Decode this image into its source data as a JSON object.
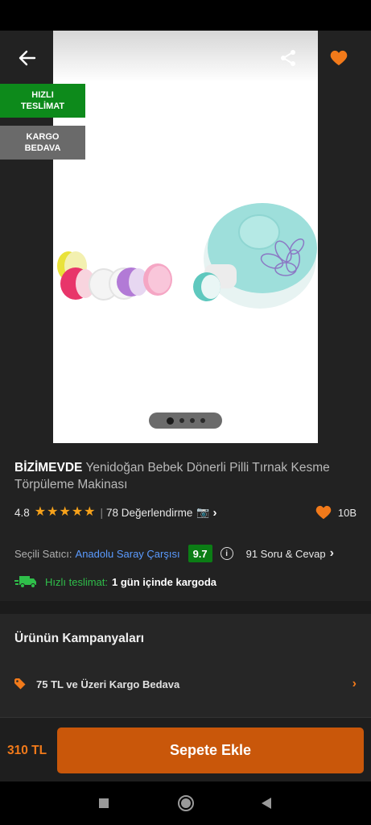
{
  "badges": {
    "fast_delivery": "HIZLI TESLİMAT",
    "free_cargo": "KARGO BEDAVA"
  },
  "gallery": {
    "image_count": 4,
    "active_index": 0
  },
  "icons": {
    "back": "back-arrow-icon",
    "share": "share-icon",
    "favorite": "heart-icon",
    "camera": "camera-icon",
    "info": "info-icon",
    "truck": "truck-icon",
    "tag": "tag-icon"
  },
  "product": {
    "brand": "BİZİMEVDE",
    "name": "Yenidoğan Bebek Dönerli Pilli Tırnak Kesme Törpüleme Makinası",
    "rating": "4.8",
    "rating_stars": 5,
    "reviews": "78 Değerlendirme",
    "favorites": "10B"
  },
  "seller": {
    "label": "Seçili Satıcı:",
    "name": "Anadolu Saray Çarşısı",
    "score": "9.7",
    "qa": "91 Soru & Cevap"
  },
  "delivery": {
    "label": "Hızlı teslimat:",
    "text": "1 gün içinde kargoda"
  },
  "campaigns": {
    "title": "Ürünün Kampanyaları",
    "items": [
      {
        "label": "75 TL ve Üzeri Kargo Bedava"
      }
    ]
  },
  "bottom": {
    "price": "310 TL",
    "add_to_cart": "Sepete Ekle"
  },
  "colors": {
    "accent": "#f27a1a",
    "button": "#c9570a",
    "green": "#0b7d15",
    "link": "#5b9bff"
  }
}
